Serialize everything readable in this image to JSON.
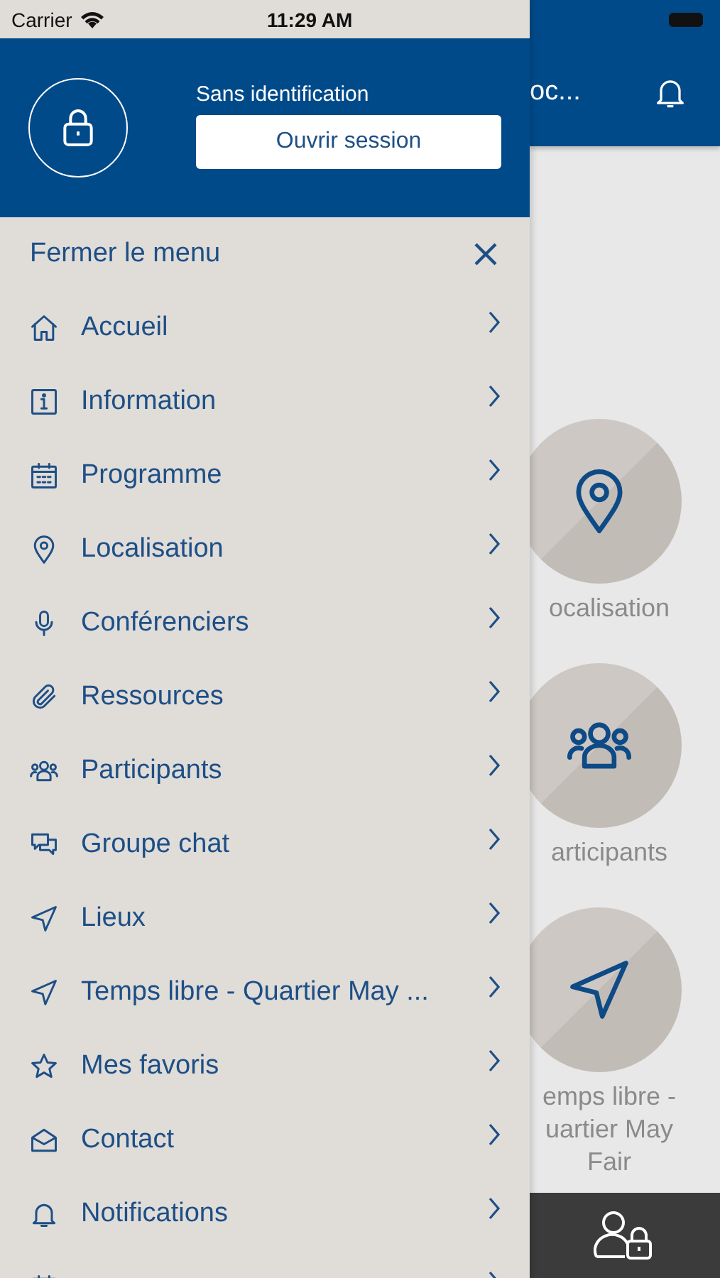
{
  "status_bar": {
    "carrier": "Carrier",
    "time": "11:29 AM"
  },
  "drawer": {
    "user_status": "Sans identification",
    "login_button": "Ouvrir session",
    "close_label": "Fermer le menu",
    "items": [
      {
        "kind": "home",
        "label": "Accueil"
      },
      {
        "kind": "info",
        "label": "Information"
      },
      {
        "kind": "calendar",
        "label": "Programme"
      },
      {
        "kind": "pin",
        "label": "Localisation"
      },
      {
        "kind": "mic",
        "label": "Conférenciers"
      },
      {
        "kind": "clip",
        "label": "Ressources"
      },
      {
        "kind": "people",
        "label": "Participants"
      },
      {
        "kind": "chat",
        "label": "Groupe chat"
      },
      {
        "kind": "nav",
        "label": "Lieux"
      },
      {
        "kind": "nav",
        "label": "Temps libre - Quartier May ..."
      },
      {
        "kind": "star",
        "label": "Mes favoris"
      },
      {
        "kind": "mail",
        "label": "Contact"
      },
      {
        "kind": "bell",
        "label": "Notifications"
      },
      {
        "kind": "calendar"
      }
    ]
  },
  "background": {
    "title": "oc...",
    "tiles": [
      {
        "kind": "pin",
        "label_lines": [
          "ocalisation"
        ]
      },
      {
        "kind": "people",
        "label_lines": [
          "articipants"
        ]
      },
      {
        "kind": "nav",
        "label_lines": [
          "emps libre -",
          "uartier May",
          "Fair"
        ]
      }
    ]
  }
}
